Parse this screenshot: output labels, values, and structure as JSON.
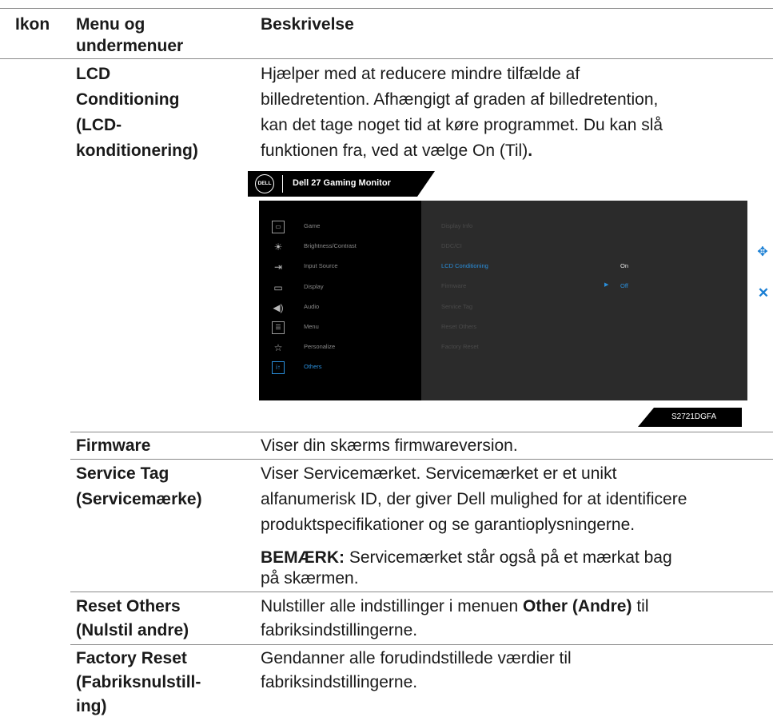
{
  "headers": {
    "icon": "Ikon",
    "menu": "Menu og undermenuer",
    "menu_l1": "Menu og",
    "menu_l2": "undermenuer",
    "desc": "Beskrivelse"
  },
  "lcd": {
    "name": [
      "LCD",
      "Conditioning",
      "(LCD-",
      "konditionering)"
    ],
    "desc": [
      "Hjælper med at reducere mindre tilfælde af",
      "billedretention. Afhængigt af graden af billedretention,",
      "kan det tage noget tid at køre programmet. Du kan slå",
      "funktionen fra, ved at vælge On (Til)"
    ],
    "desc_end": "."
  },
  "osd": {
    "logo": "DELL",
    "title": "Dell 27 Gaming Monitor",
    "menu": [
      {
        "label": "Game",
        "icon": "game-icon"
      },
      {
        "label": "Brightness/Contrast",
        "icon": "brightness-icon"
      },
      {
        "label": "Input Source",
        "icon": "input-source-icon"
      },
      {
        "label": "Display",
        "icon": "display-icon"
      },
      {
        "label": "Audio",
        "icon": "audio-icon"
      },
      {
        "label": "Menu",
        "icon": "menu-icon"
      },
      {
        "label": "Personalize",
        "icon": "star-icon"
      },
      {
        "label": "Others",
        "icon": "others-icon"
      }
    ],
    "submenu": [
      "Display Info",
      "DDC/CI",
      "LCD Conditioning",
      "Firmware",
      "Service Tag",
      "Reset Others",
      "Factory Reset"
    ],
    "option_on": "On",
    "option_off": "Off",
    "model": "S2721DGFA",
    "accent": "#2a8fdc"
  },
  "firmware": {
    "name": "Firmware",
    "desc": "Viser din skærms firmwareversion."
  },
  "service_tag": {
    "name": [
      "Service Tag",
      "(Servicemærke)"
    ],
    "desc": [
      "Viser Servicemærket. Servicemærket er et unikt",
      "alfanumerisk ID, der giver Dell mulighed for at identificere",
      "produktspecifikationer og se garantioplysningerne."
    ],
    "note_label": "BEMÆRK:",
    "note": [
      " Servicemærket står også på et mærkat bag",
      "på skærmen."
    ]
  },
  "reset_others": {
    "name": [
      "Reset Others",
      "(Nulstil andre)"
    ],
    "desc_pre": "Nulstiller alle indstillinger i menuen ",
    "desc_bold": "Other (Andre)",
    "desc_post": " til",
    "desc_l2": "fabriksindstillingerne."
  },
  "factory_reset": {
    "name": [
      "Factory Reset",
      "(Fabriksnulstill-",
      "ing)"
    ],
    "desc": [
      "Gendanner alle forudindstillede værdier til",
      "fabriksindstillingerne."
    ]
  }
}
